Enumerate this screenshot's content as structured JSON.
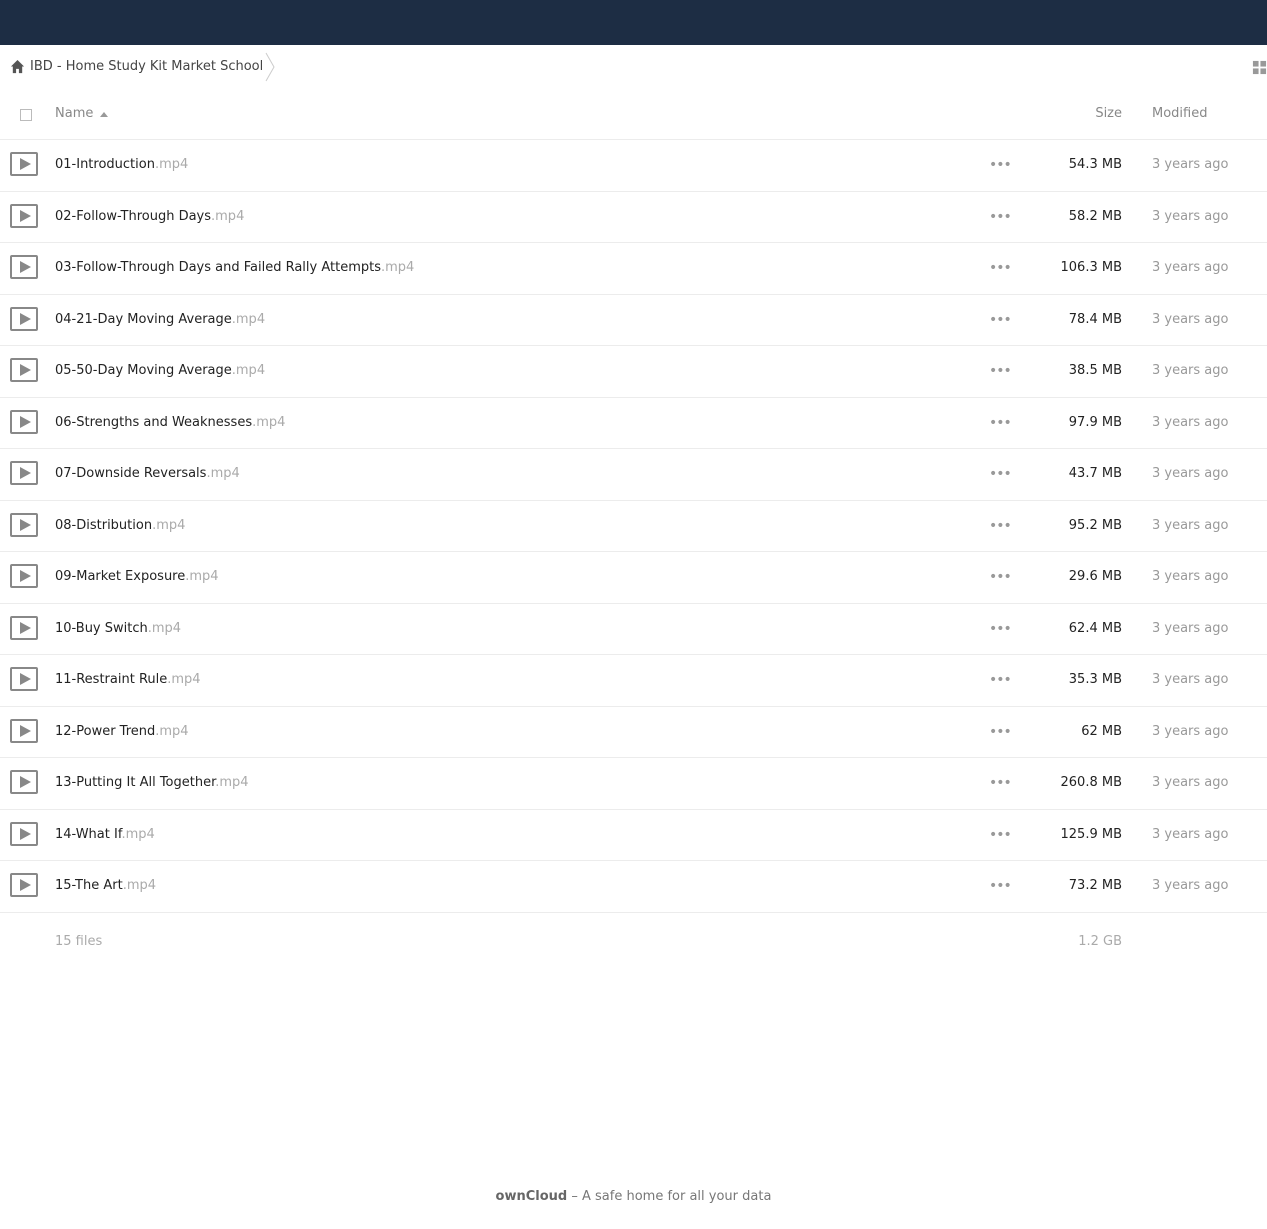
{
  "breadcrumb": {
    "label": "IBD - Home Study Kit Market School"
  },
  "table": {
    "headers": {
      "name": "Name",
      "size": "Size",
      "modified": "Modified"
    },
    "files": [
      {
        "name": "01-Introduction",
        "ext": ".mp4",
        "size": "54.3 MB",
        "modified": "3 years ago"
      },
      {
        "name": "02-Follow-Through Days",
        "ext": ".mp4",
        "size": "58.2 MB",
        "modified": "3 years ago"
      },
      {
        "name": "03-Follow-Through Days and Failed Rally Attempts",
        "ext": ".mp4",
        "size": "106.3 MB",
        "modified": "3 years ago"
      },
      {
        "name": "04-21-Day Moving Average",
        "ext": ".mp4",
        "size": "78.4 MB",
        "modified": "3 years ago"
      },
      {
        "name": "05-50-Day Moving Average",
        "ext": ".mp4",
        "size": "38.5 MB",
        "modified": "3 years ago"
      },
      {
        "name": "06-Strengths and Weaknesses",
        "ext": ".mp4",
        "size": "97.9 MB",
        "modified": "3 years ago"
      },
      {
        "name": "07-Downside Reversals",
        "ext": ".mp4",
        "size": "43.7 MB",
        "modified": "3 years ago"
      },
      {
        "name": "08-Distribution",
        "ext": ".mp4",
        "size": "95.2 MB",
        "modified": "3 years ago"
      },
      {
        "name": "09-Market Exposure",
        "ext": ".mp4",
        "size": "29.6 MB",
        "modified": "3 years ago"
      },
      {
        "name": "10-Buy Switch",
        "ext": ".mp4",
        "size": "62.4 MB",
        "modified": "3 years ago"
      },
      {
        "name": "11-Restraint Rule",
        "ext": ".mp4",
        "size": "35.3 MB",
        "modified": "3 years ago"
      },
      {
        "name": "12-Power Trend",
        "ext": ".mp4",
        "size": "62 MB",
        "modified": "3 years ago"
      },
      {
        "name": "13-Putting It All Together",
        "ext": ".mp4",
        "size": "260.8 MB",
        "modified": "3 years ago"
      },
      {
        "name": "14-What If",
        "ext": ".mp4",
        "size": "125.9 MB",
        "modified": "3 years ago"
      },
      {
        "name": "15-The Art",
        "ext": ".mp4",
        "size": "73.2 MB",
        "modified": "3 years ago"
      }
    ],
    "summary": {
      "files": "15 files",
      "size": "1.2 GB"
    }
  },
  "footer": {
    "brand": "ownCloud",
    "tagline": " – A safe home for all your data"
  },
  "icons": {
    "home": "home-icon",
    "file": "video-file-icon",
    "more": "more-icon",
    "view": "grid-view-icon"
  },
  "colors": {
    "topbar": "#1d2d44"
  }
}
